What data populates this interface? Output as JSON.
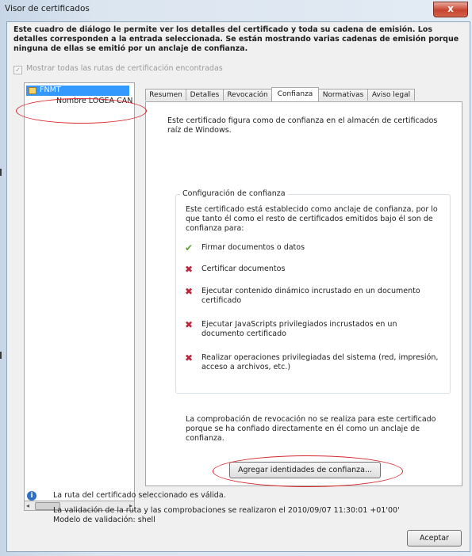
{
  "window": {
    "title": "Visor de certificados",
    "close_glyph": "x"
  },
  "intro_text": "Este cuadro de diálogo le permite ver los detalles del certificado y toda su cadena de emisión. Los detalles corresponden a la entrada seleccionada. Se están mostrando varias cadenas de emisión porque ninguna de ellas se emitió por un anclaje de confianza.",
  "show_all_paths": {
    "label": "Mostrar todas las rutas de certificación encontradas",
    "checked": true,
    "enabled": false
  },
  "tree": {
    "root": "FNMT",
    "child": "Nombre LOGEA CAN",
    "selected": "FNMT",
    "icon": "certificate-icon"
  },
  "tabs": [
    {
      "label": "Resumen"
    },
    {
      "label": "Detalles"
    },
    {
      "label": "Revocación"
    },
    {
      "label": "Confianza"
    },
    {
      "label": "Normativas"
    },
    {
      "label": "Aviso legal"
    }
  ],
  "active_tab": "Confianza",
  "trust": {
    "intro": "Este certificado figura como de confianza en el almacén de certificados raíz de Windows.",
    "group_title": "Configuración de confianza",
    "group_desc": "Este certificado está establecido como anclaje de confianza, por lo que tanto él como el resto de certificados emitidos bajo él son de confianza para:",
    "purposes": [
      {
        "icon": "checkmark-icon",
        "glyph": "✔",
        "label": "Firmar documentos o datos"
      },
      {
        "icon": "cross-icon",
        "glyph": "✖",
        "label": "Certificar documentos"
      },
      {
        "icon": "cross-icon",
        "glyph": "✖",
        "label": "Ejecutar contenido dinámico incrustado en un documento certificado"
      },
      {
        "icon": "cross-icon",
        "glyph": "✖",
        "label": "Ejecutar JavaScripts privilegiados incrustados en un documento certificado"
      },
      {
        "icon": "cross-icon",
        "glyph": "✖",
        "label": "Realizar operaciones privilegiadas del sistema (red, impresión, acceso a archivos, etc.)"
      }
    ],
    "revocation_note": "La comprobación de revocación no se realiza para este certificado porque se ha confiado directamente en él como un anclaje de confianza.",
    "add_button": "Agregar identidades de confianza..."
  },
  "status": {
    "icon": "info-icon",
    "glyph": "i",
    "message": "La ruta del certificado seleccionado es válida.",
    "validation": "La validación de la ruta y las comprobaciones se realizaron el 2010/09/07 11:30:01 +01'00'",
    "model": "Modelo de validación: shell"
  },
  "ok_button": "Aceptar",
  "colors": {
    "selection": "#3399ff",
    "annotation_oval": "#d8272a",
    "check_green": "#5aa62b",
    "cross_red": "#c0243a"
  }
}
